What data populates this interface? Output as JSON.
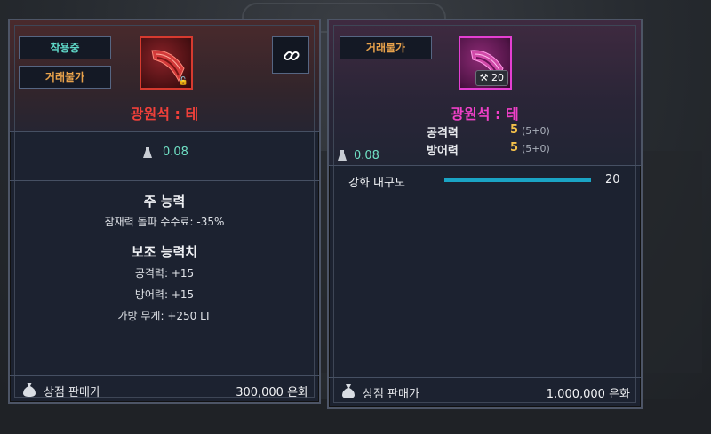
{
  "left_card": {
    "tag_equipped": "착용중",
    "tag_untradable": "거래불가",
    "item_name": "광원석 : 테",
    "weight": "0.08",
    "main_ability_title": "주 능력",
    "main_ability_line": "잠재력 돌파 수수료: -35%",
    "sub_ability_title": "보조 능력치",
    "sub_lines": [
      "공격력: +15",
      "방어력: +15",
      "가방 무게: +250 LT"
    ],
    "shop_label": "상점 판매가",
    "shop_price": "300,000 은화"
  },
  "right_card": {
    "tag_untradable": "거래불가",
    "enhance_level": "20",
    "item_name": "광원석 : 테",
    "weight": "0.08",
    "stats": [
      {
        "label": "공격력",
        "value": "5",
        "detail": "(5+0)"
      },
      {
        "label": "방어력",
        "value": "5",
        "detail": "(5+0)"
      }
    ],
    "durability_label": "강화 내구도",
    "durability_value": "20",
    "durability_fraction": 1.0,
    "shop_label": "상점 판매가",
    "shop_price": "1,000,000 은화"
  },
  "colors": {
    "accent_teal": "#5fd8c8",
    "accent_orange": "#e8a24b",
    "name_red": "#f0403a",
    "name_pink": "#f040c8",
    "durability_bar": "#1aa4c4"
  },
  "icons": [
    "crystal-item-icon",
    "lock-icon",
    "link-icon",
    "weight-icon",
    "silver-bag-icon",
    "hammer-icon"
  ]
}
